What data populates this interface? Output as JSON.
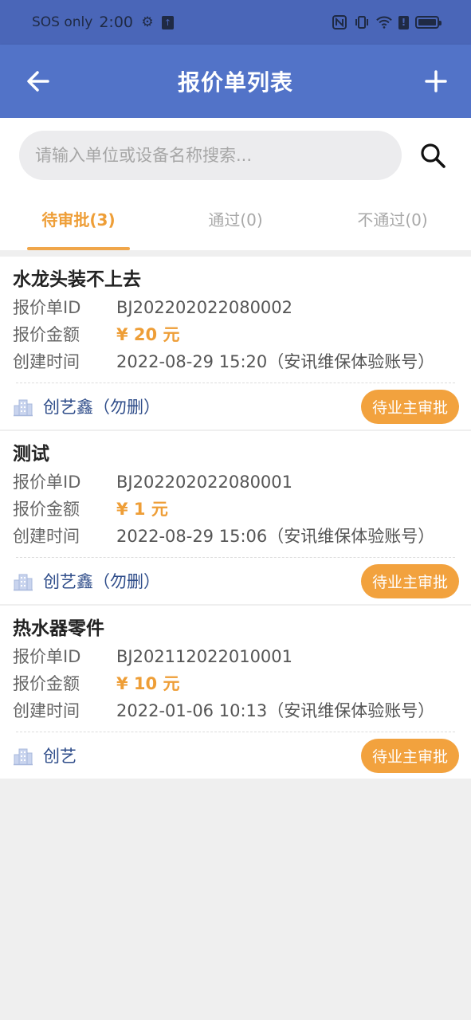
{
  "status_bar": {
    "carrier": "SOS only",
    "time": "2:00",
    "battery_icon": "battery-icon"
  },
  "app_bar": {
    "title": "报价单列表",
    "back_icon": "back-arrow-icon",
    "add_icon": "plus-icon"
  },
  "search": {
    "placeholder": "请输入单位或设备名称搜索...",
    "value": ""
  },
  "tabs": [
    {
      "label": "待审批(3)",
      "active": true
    },
    {
      "label": "通过(0)",
      "active": false
    },
    {
      "label": "不通过(0)",
      "active": false
    }
  ],
  "field_labels": {
    "id": "报价单ID",
    "amount": "报价金额",
    "created": "创建时间"
  },
  "quotes": [
    {
      "title": "水龙头装不上去",
      "id": "BJ202202022080002",
      "amount": "¥ 20 元",
      "created": "2022-08-29 15:20（安讯维保体验账号）",
      "company": "创艺鑫（勿删）",
      "status": "待业主审批"
    },
    {
      "title": "测试",
      "id": "BJ202202022080001",
      "amount": "¥ 1 元",
      "created": "2022-08-29 15:06（安讯维保体验账号）",
      "company": "创艺鑫（勿删）",
      "status": "待业主审批"
    },
    {
      "title": "热水器零件",
      "id": "BJ202112022010001",
      "amount": "¥ 10 元",
      "created": "2022-01-06 10:13（安讯维保体验账号）",
      "company": "创艺",
      "status": "待业主审批"
    }
  ],
  "colors": {
    "primary": "#5273c8",
    "accent": "#ee9e37",
    "badge": "#f2a23e",
    "company_text": "#2f4d8a"
  }
}
